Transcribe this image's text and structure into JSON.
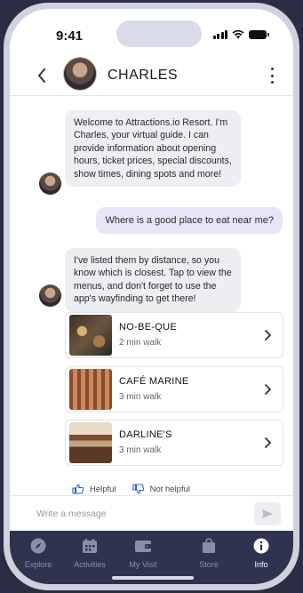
{
  "status": {
    "time": "9:41"
  },
  "header": {
    "name": "CHARLES"
  },
  "messages": {
    "welcome": "Welcome to Attractions.io Resort. I'm Charles, your virtual guide. I can provide information about opening hours, ticket prices, special discounts, show times, dining spots and more!",
    "user_question": "Where is a good place to eat near me?",
    "reply": "I've listed them by distance, so you know which is closest. Tap to view the menus, and don't forget to use the app's wayfinding to get there!"
  },
  "places": [
    {
      "name": "NO-BE-QUE",
      "walk": "2 min walk"
    },
    {
      "name": "CAFÉ MARINE",
      "walk": "3 min walk"
    },
    {
      "name": "DARLINE'S",
      "walk": "3 min walk"
    }
  ],
  "feedback": {
    "helpful": "Helpful",
    "not_helpful": "Not helpful"
  },
  "input": {
    "placeholder": "Write a message"
  },
  "tabs": [
    {
      "label": "Explore",
      "icon": "compass-icon"
    },
    {
      "label": "Activities",
      "icon": "calendar-icon"
    },
    {
      "label": "My Visit",
      "icon": "wallet-icon"
    },
    {
      "label": "Store",
      "icon": "shopping-bag-icon"
    },
    {
      "label": "Info",
      "icon": "info-icon"
    }
  ],
  "colors": {
    "tab_bar": "#2e3350",
    "background": "#2b2d45",
    "user_bubble": "#e6e6f8",
    "bot_bubble": "#eceef2"
  }
}
